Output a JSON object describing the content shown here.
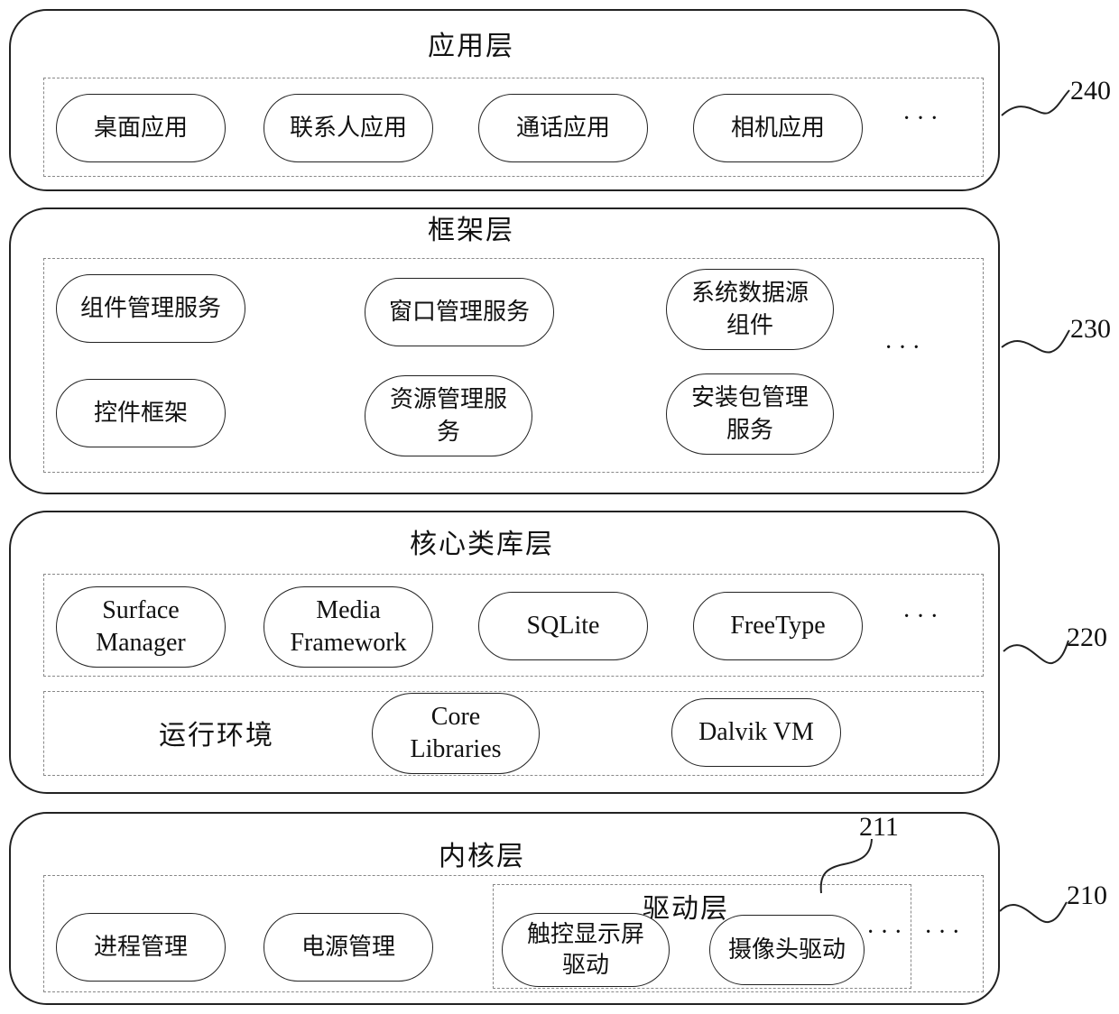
{
  "layers": {
    "app": {
      "title": "应用层",
      "ref": "240",
      "items": [
        "桌面应用",
        "联系人应用",
        "通话应用",
        "相机应用"
      ],
      "ellipsis": "···"
    },
    "framework": {
      "title": "框架层",
      "ref": "230",
      "items": [
        {
          "line1": "组件管理服务",
          "line2": ""
        },
        {
          "line1": "窗口管理服务",
          "line2": ""
        },
        {
          "line1": "系统数据源",
          "line2": "组件"
        },
        {
          "line1": "控件框架",
          "line2": ""
        },
        {
          "line1": "资源管理服",
          "line2": "务"
        },
        {
          "line1": "安装包管理",
          "line2": "服务"
        }
      ],
      "ellipsis": "···"
    },
    "core": {
      "title": "核心类库层",
      "ref": "220",
      "items": [
        {
          "line1": "Surface",
          "line2": "Manager"
        },
        {
          "line1": "Media",
          "line2": "Framework"
        },
        {
          "line1": "SQLite",
          "line2": ""
        },
        {
          "line1": "FreeType",
          "line2": ""
        }
      ],
      "ellipsis": "···",
      "runtime": {
        "label": "运行环境",
        "items": [
          {
            "line1": "Core",
            "line2": "Libraries"
          },
          {
            "line1": "Dalvik VM",
            "line2": ""
          }
        ]
      }
    },
    "kernel": {
      "title": "内核层",
      "ref": "210",
      "items": [
        "进程管理",
        "电源管理"
      ],
      "ellipsis": "···",
      "driver": {
        "title": "驱动层",
        "ref": "211",
        "items": [
          {
            "line1": "触控显示屏",
            "line2": "驱动"
          },
          {
            "line1": "摄像头驱动",
            "line2": ""
          }
        ],
        "ellipsis": "···"
      }
    }
  }
}
